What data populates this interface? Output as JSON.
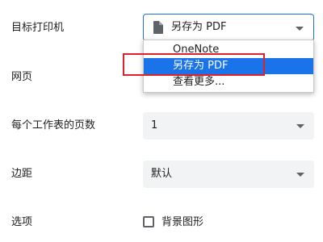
{
  "settings": {
    "destination": {
      "label": "目标打印机",
      "value": "另存为 PDF",
      "options": [
        "OneNote",
        "另存为 PDF",
        "查看更多..."
      ],
      "selected_index": 1,
      "icon": "document-icon"
    },
    "pages": {
      "label": "网页"
    },
    "pages_per_sheet": {
      "label": "每个工作表的页数",
      "value": "1"
    },
    "margins": {
      "label": "边距",
      "value": "默认"
    },
    "options": {
      "label": "选项",
      "checkbox_label": "背景图形",
      "checked": false
    }
  },
  "colors": {
    "accent": "#1a73e8",
    "highlight_box": "#e0202a",
    "field_bg": "#f1f3f4"
  }
}
